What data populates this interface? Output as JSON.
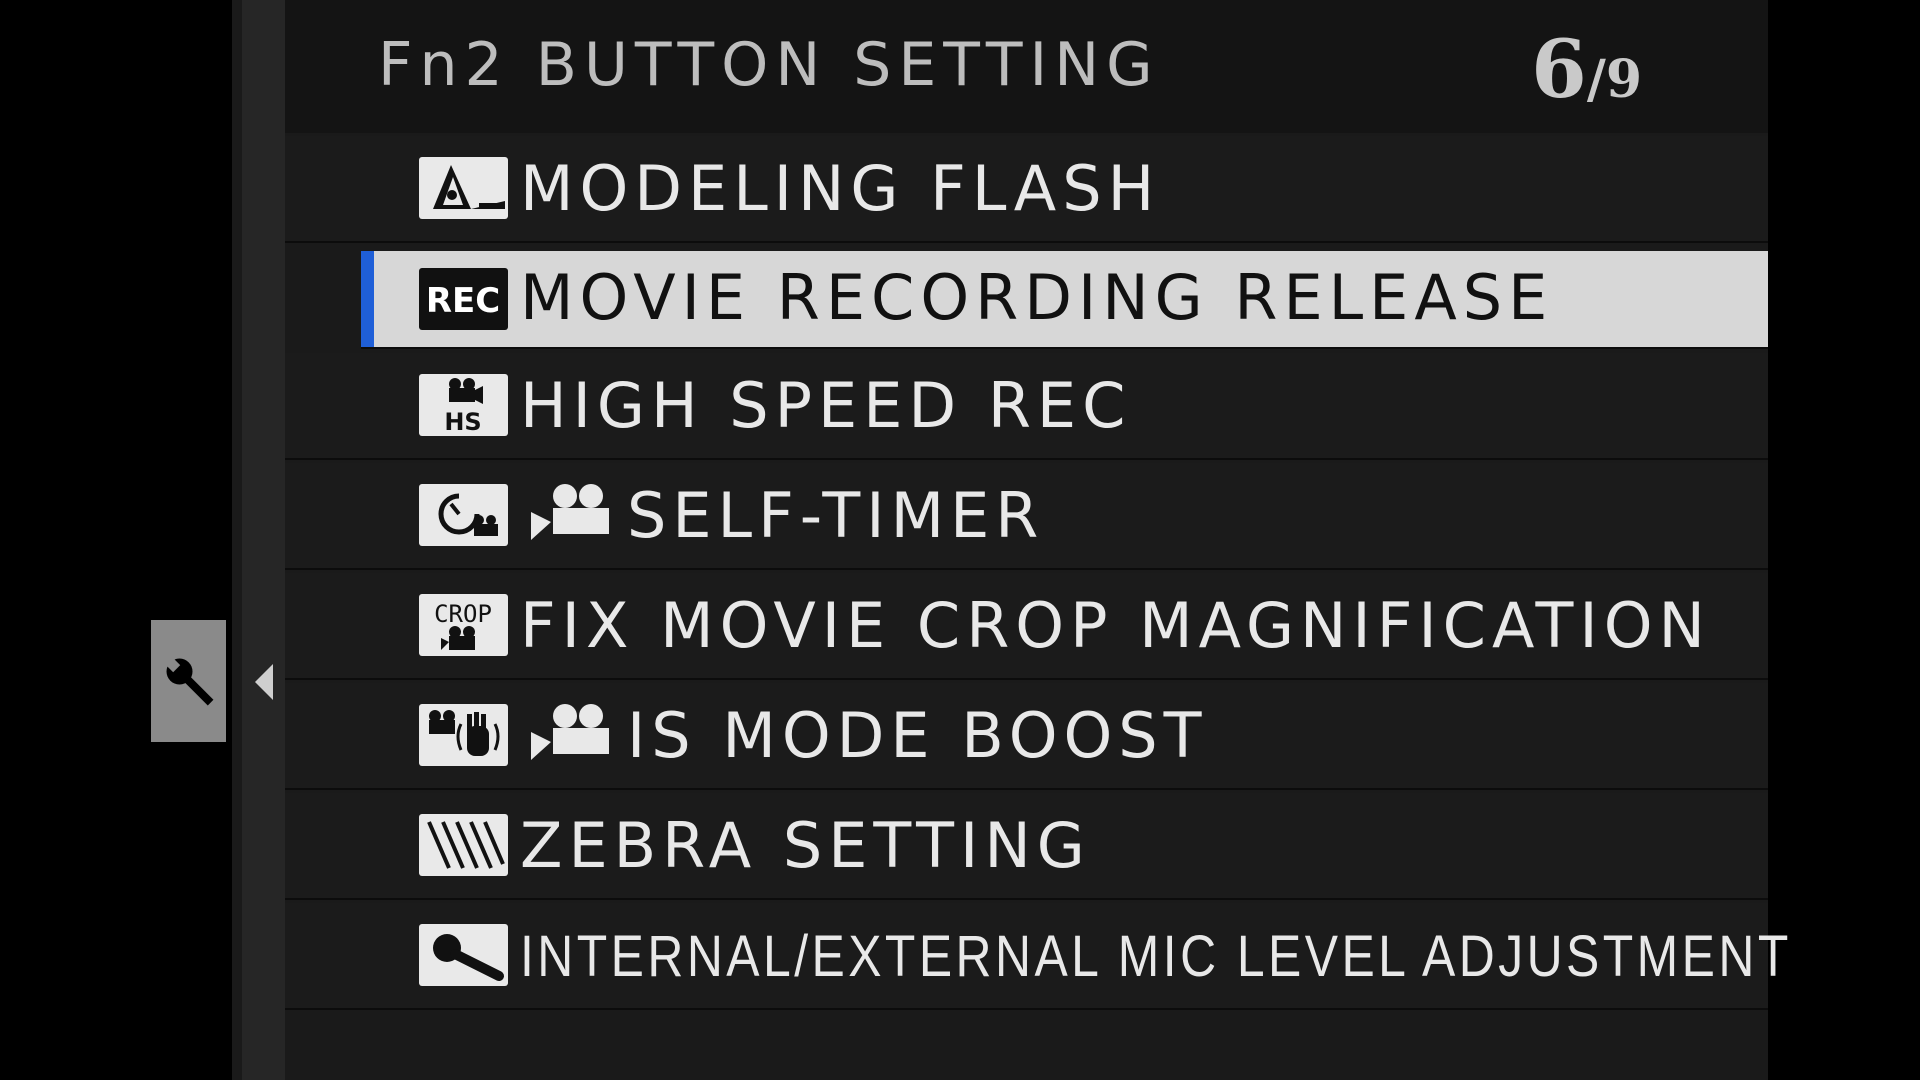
{
  "header": {
    "title": "Fn2 BUTTON SETTING",
    "page_current": "6",
    "page_separator": "/",
    "page_total": "9"
  },
  "side_tab": {
    "icon": "wrench-icon"
  },
  "menu": {
    "selected_index": 1,
    "items": [
      {
        "label": "MODELING FLASH",
        "icon": "modeling-flash-icon"
      },
      {
        "label": "MOVIE RECORDING RELEASE",
        "icon": "rec-icon",
        "icon_text": "REC"
      },
      {
        "label": "HIGH SPEED REC",
        "icon": "high-speed-rec-icon",
        "icon_text": "HS"
      },
      {
        "label": "SELF-TIMER",
        "icon": "self-timer-icon",
        "prefix_icon": "movie-camera-icon"
      },
      {
        "label": "FIX MOVIE CROP MAGNIFICATION",
        "icon": "crop-icon",
        "icon_text": "CROP"
      },
      {
        "label": "IS MODE BOOST",
        "icon": "is-mode-icon",
        "prefix_icon": "movie-camera-icon"
      },
      {
        "label": "ZEBRA SETTING",
        "icon": "zebra-icon"
      },
      {
        "label": "INTERNAL/EXTERNAL MIC LEVEL ADJUSTMENT",
        "icon": "microphone-icon"
      }
    ]
  },
  "colors": {
    "selection_bar": "#1f5fd8",
    "selected_row": "#d7d7d7",
    "row_bg": "#1b1b1b"
  }
}
